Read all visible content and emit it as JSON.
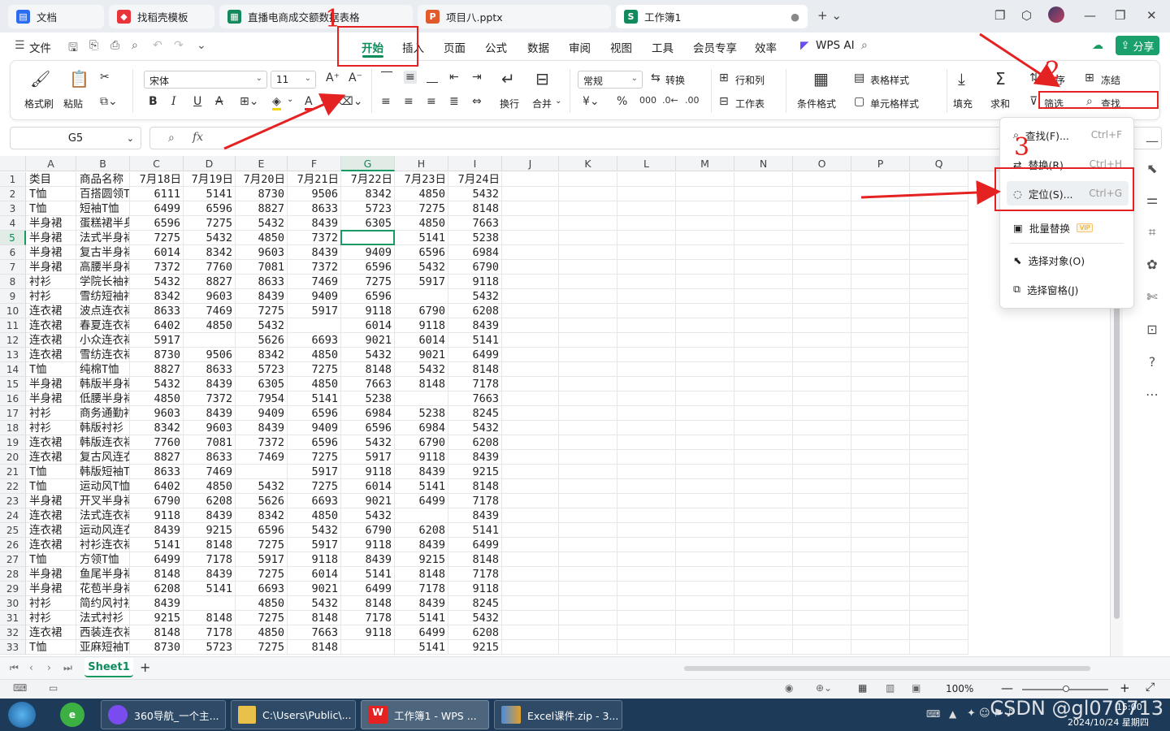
{
  "tabs": [
    {
      "label": "文档",
      "icon": "docs-icon",
      "color": "#2b6cf0",
      "glyph": "W"
    },
    {
      "label": "找稻壳模板",
      "icon": "docer-icon",
      "color": "#e8343a",
      "glyph": "D"
    },
    {
      "label": "直播电商成交额数据表格",
      "icon": "sheet-icon",
      "color": "#138a5e",
      "glyph": "S"
    },
    {
      "label": "项目八.pptx",
      "icon": "ppt-icon",
      "color": "#e05a2b",
      "glyph": "P"
    },
    {
      "label": "工作簿1",
      "icon": "sheet-icon",
      "color": "#138a5e",
      "glyph": "S"
    }
  ],
  "menu": {
    "file": "文件",
    "items": [
      "开始",
      "插入",
      "页面",
      "公式",
      "数据",
      "审阅",
      "视图",
      "工具",
      "会员专享",
      "效率"
    ],
    "active": "开始",
    "wps_ai": "WPS AI",
    "share": "分享"
  },
  "ribbon": {
    "format_painter": "格式刷",
    "paste": "粘贴",
    "font_name": "宋体",
    "font_size": "11",
    "number_format": "常规",
    "convert": "转换",
    "wrap": "换行",
    "merge": "合并",
    "row_col": "行和列",
    "worksheet": "工作表",
    "cond_format": "条件格式",
    "table_style": "表格样式",
    "cell_style": "单元格样式",
    "fill": "填充",
    "sum": "求和",
    "sort": "排序",
    "filter": "筛选",
    "freeze": "冻结",
    "find": "查找"
  },
  "formula_bar": {
    "cell": "G5",
    "fx": "fx"
  },
  "columns": [
    "A",
    "B",
    "C",
    "D",
    "E",
    "F",
    "G",
    "H",
    "I",
    "J",
    "K",
    "L",
    "M",
    "N",
    "O",
    "P",
    "Q"
  ],
  "rows": [
    [
      "类目",
      "商品名称",
      "7月18日",
      "7月19日",
      "7月20日",
      "7月21日",
      "7月22日",
      "7月23日",
      "7月24日"
    ],
    [
      "T恤",
      "百搭圆领T恤",
      "6111",
      "5141",
      "8730",
      "9506",
      "8342",
      "4850",
      "5432"
    ],
    [
      "T恤",
      "短袖T恤",
      "6499",
      "6596",
      "8827",
      "8633",
      "5723",
      "7275",
      "8148"
    ],
    [
      "半身裙",
      "蛋糕裙半身裙",
      "6596",
      "7275",
      "5432",
      "8439",
      "6305",
      "4850",
      "7663"
    ],
    [
      "半身裙",
      "法式半身裙",
      "7275",
      "5432",
      "4850",
      "7372",
      "",
      "5141",
      "5238"
    ],
    [
      "半身裙",
      "复古半身裙",
      "6014",
      "8342",
      "9603",
      "8439",
      "9409",
      "6596",
      "6984"
    ],
    [
      "半身裙",
      "高腰半身裙",
      "7372",
      "7760",
      "7081",
      "7372",
      "6596",
      "5432",
      "6790"
    ],
    [
      "衬衫",
      "学院长袖衬衫",
      "5432",
      "8827",
      "8633",
      "7469",
      "7275",
      "5917",
      "9118"
    ],
    [
      "衬衫",
      "雪纺短袖衬衫",
      "8342",
      "9603",
      "8439",
      "9409",
      "6596",
      "",
      "5432"
    ],
    [
      "连衣裙",
      "波点连衣裙",
      "8633",
      "7469",
      "7275",
      "5917",
      "9118",
      "6790",
      "6208"
    ],
    [
      "连衣裙",
      "春夏连衣裙",
      "6402",
      "4850",
      "5432",
      "",
      "6014",
      "9118",
      "8439"
    ],
    [
      "连衣裙",
      "小众连衣裙",
      "5917",
      "",
      "5626",
      "6693",
      "9021",
      "6014",
      "5141"
    ],
    [
      "连衣裙",
      "雪纺连衣裙",
      "8730",
      "9506",
      "8342",
      "4850",
      "5432",
      "9021",
      "6499"
    ],
    [
      "T恤",
      "纯棉T恤",
      "8827",
      "8633",
      "5723",
      "7275",
      "8148",
      "5432",
      "8148"
    ],
    [
      "半身裙",
      "韩版半身裙",
      "5432",
      "8439",
      "6305",
      "4850",
      "7663",
      "8148",
      "7178"
    ],
    [
      "半身裙",
      "低腰半身裙",
      "4850",
      "7372",
      "7954",
      "5141",
      "5238",
      "",
      "7663"
    ],
    [
      "衬衫",
      "商务通勤衬衫",
      "9603",
      "8439",
      "9409",
      "6596",
      "6984",
      "5238",
      "8245"
    ],
    [
      "衬衫",
      "韩版衬衫",
      "8342",
      "9603",
      "8439",
      "9409",
      "6596",
      "6984",
      "5432"
    ],
    [
      "连衣裙",
      "韩版连衣裙",
      "7760",
      "7081",
      "7372",
      "6596",
      "5432",
      "6790",
      "6208"
    ],
    [
      "连衣裙",
      "复古风连衣裙",
      "8827",
      "8633",
      "7469",
      "7275",
      "5917",
      "9118",
      "8439"
    ],
    [
      "T恤",
      "韩版短袖T恤",
      "8633",
      "7469",
      "",
      "5917",
      "9118",
      "8439",
      "9215"
    ],
    [
      "T恤",
      "运动风T恤",
      "6402",
      "4850",
      "5432",
      "7275",
      "6014",
      "5141",
      "8148"
    ],
    [
      "半身裙",
      "开叉半身裙",
      "6790",
      "6208",
      "5626",
      "6693",
      "9021",
      "6499",
      "7178"
    ],
    [
      "连衣裙",
      "法式连衣裙",
      "9118",
      "8439",
      "8342",
      "4850",
      "5432",
      "",
      "8439"
    ],
    [
      "连衣裙",
      "运动风连衣裙",
      "8439",
      "9215",
      "6596",
      "5432",
      "6790",
      "6208",
      "5141"
    ],
    [
      "连衣裙",
      "衬衫连衣裙",
      "5141",
      "8148",
      "7275",
      "5917",
      "9118",
      "8439",
      "6499"
    ],
    [
      "T恤",
      "方领T恤",
      "6499",
      "7178",
      "5917",
      "9118",
      "8439",
      "9215",
      "8148"
    ],
    [
      "半身裙",
      "鱼尾半身裙",
      "8148",
      "8439",
      "7275",
      "6014",
      "5141",
      "8148",
      "7178"
    ],
    [
      "半身裙",
      "花苞半身裙",
      "6208",
      "5141",
      "6693",
      "9021",
      "6499",
      "7178",
      "9118"
    ],
    [
      "衬衫",
      "简约风衬衫",
      "8439",
      "",
      "4850",
      "5432",
      "8148",
      "8439",
      "8245"
    ],
    [
      "衬衫",
      "法式衬衫",
      "9215",
      "8148",
      "7275",
      "8148",
      "7178",
      "5141",
      "5432"
    ],
    [
      "连衣裙",
      "西装连衣裙",
      "8148",
      "7178",
      "4850",
      "7663",
      "9118",
      "6499",
      "6208"
    ],
    [
      "T恤",
      "亚麻短袖T恤",
      "8730",
      "5723",
      "7275",
      "8148",
      "",
      "5141",
      "9215"
    ]
  ],
  "dropdown": [
    {
      "label": "查找(F)...",
      "shortcut": "Ctrl+F",
      "icon": "magnifier-icon"
    },
    {
      "label": "替换(R)...",
      "shortcut": "Ctrl+H",
      "icon": "replace-icon"
    },
    {
      "label": "定位(S)...",
      "shortcut": "Ctrl+G",
      "icon": "locate-icon"
    },
    {
      "label": "批量替换",
      "shortcut": "",
      "icon": "batch-replace-icon",
      "badge": "VIP"
    },
    {
      "label": "选择对象(O)",
      "shortcut": "",
      "icon": "select-object-icon"
    },
    {
      "label": "选择窗格(J)",
      "shortcut": "",
      "icon": "select-pane-icon"
    }
  ],
  "annotations": {
    "step1": "1",
    "step2": "2",
    "step3": "3",
    "color": "#e52222"
  },
  "sheet": {
    "name": "Sheet1",
    "zoom": "100%"
  },
  "taskbar": [
    {
      "label": "360导航_一个主...",
      "icon": "ai-browser-icon"
    },
    {
      "label": "C:\\Users\\Public\\...",
      "icon": "folder-icon"
    },
    {
      "label": "工作簿1 - WPS ...",
      "icon": "wps-icon"
    },
    {
      "label": "Excel课件.zip - 3...",
      "icon": "zip-icon"
    }
  ],
  "tray": {
    "time": "15:00",
    "date": "2024/10/24 星期四",
    "watermark": "CSDN @gl070713"
  }
}
